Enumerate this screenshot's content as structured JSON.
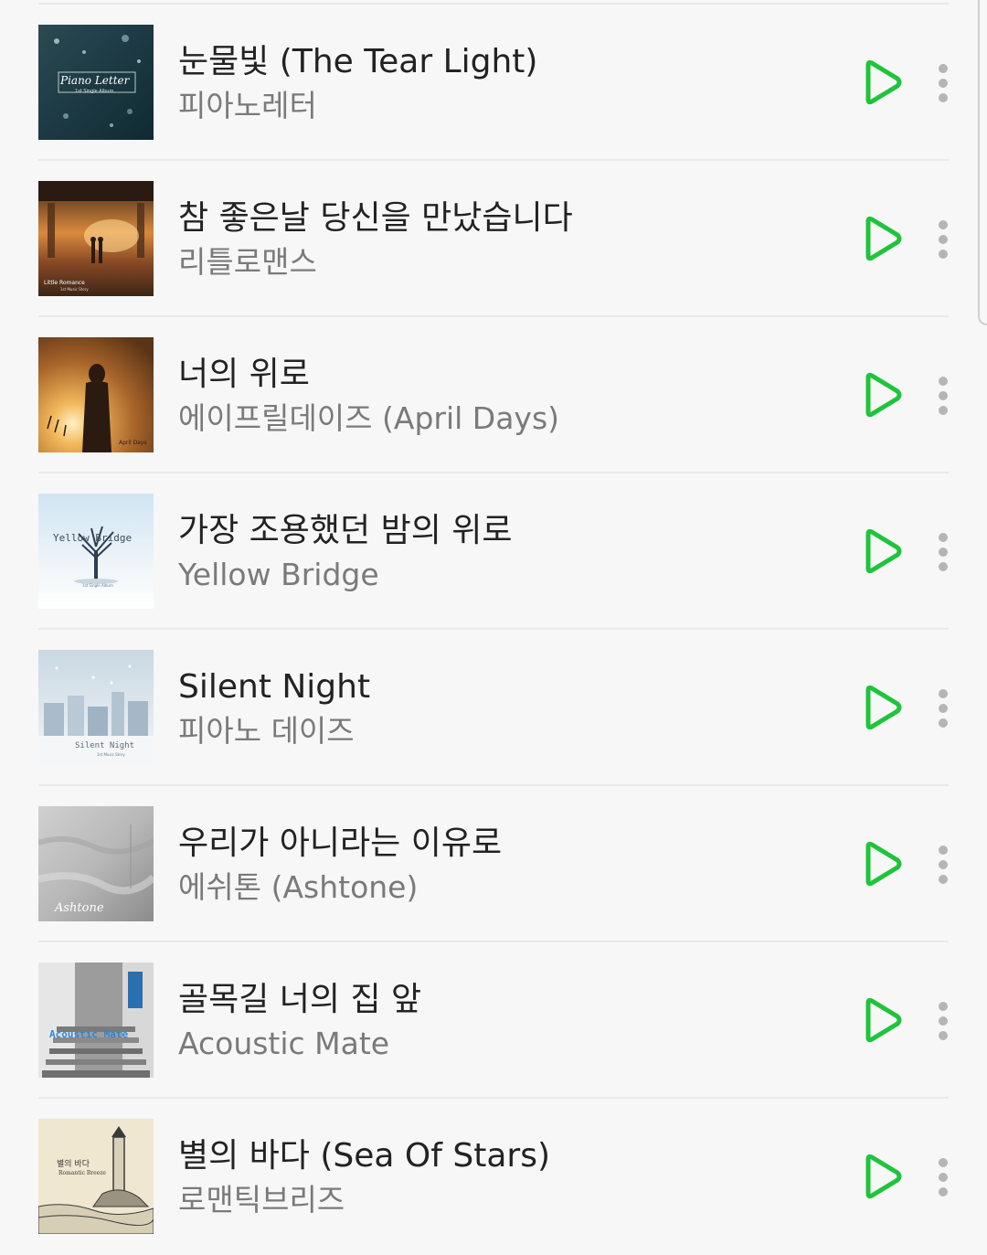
{
  "accent_color": "#1fc43a",
  "songs": [
    {
      "title": "눈물빛 (The Tear Light)",
      "artist": "피아노레터",
      "art_text": "Piano Letter",
      "art_subtext": "1st Single Album"
    },
    {
      "title": "참 좋은날 당신을 만났습니다",
      "artist": "리틀로맨스",
      "art_text": "Little Romance",
      "art_subtext": "1st Music Story"
    },
    {
      "title": "너의 위로",
      "artist": "에이프릴데이즈 (April Days)",
      "art_text": "April Days",
      "art_subtext": ""
    },
    {
      "title": "가장 조용했던 밤의 위로",
      "artist": "Yellow Bridge",
      "art_text": "Yellow Bridge",
      "art_subtext": "1st Single Album"
    },
    {
      "title": "Silent Night",
      "artist": "피아노 데이즈",
      "art_text": "Silent Night",
      "art_subtext": "1st Music Story"
    },
    {
      "title": "우리가 아니라는 이유로",
      "artist": "에쉬톤 (Ashtone)",
      "art_text": "Ashtone",
      "art_subtext": ""
    },
    {
      "title": "골목길 너의 집 앞",
      "artist": "Acoustic Mate",
      "art_text": "Acoustic Mate",
      "art_subtext": ""
    },
    {
      "title": "별의 바다 (Sea Of Stars)",
      "artist": "로맨틱브리즈",
      "art_text": "별의 바다",
      "art_subtext": "Romantic Breeze"
    }
  ],
  "icons": {
    "play": "play-icon",
    "more": "more-vertical-icon"
  }
}
